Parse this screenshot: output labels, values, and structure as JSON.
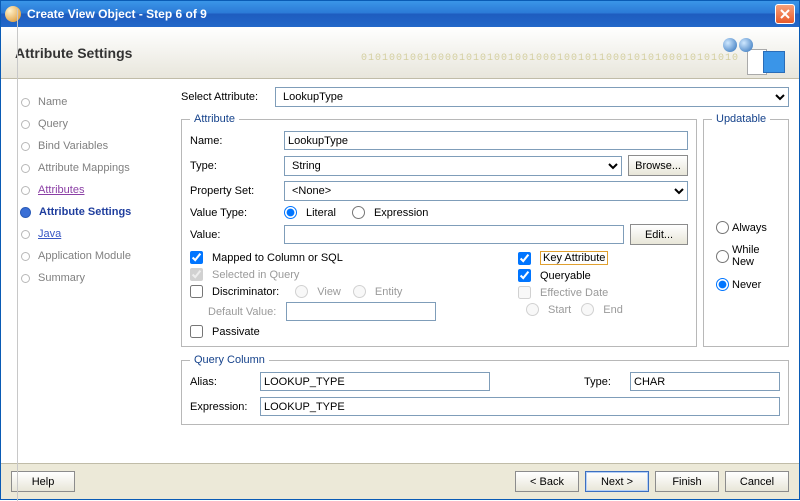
{
  "window": {
    "title": "Create View Object - Step 6 of 9"
  },
  "header": {
    "title": "Attribute Settings",
    "binary": "010100100100001010100100100010010110001010100010101010"
  },
  "nav": {
    "items": [
      {
        "label": "Name"
      },
      {
        "label": "Query"
      },
      {
        "label": "Bind Variables"
      },
      {
        "label": "Attribute Mappings"
      },
      {
        "label": "Attributes"
      },
      {
        "label": "Attribute Settings"
      },
      {
        "label": "Java"
      },
      {
        "label": "Application Module"
      },
      {
        "label": "Summary"
      }
    ]
  },
  "select_attr": {
    "label": "Select Attribute:",
    "value": "LookupType"
  },
  "attribute": {
    "legend": "Attribute",
    "name_label": "Name:",
    "name_value": "LookupType",
    "type_label": "Type:",
    "type_value": "String",
    "browse_btn": "Browse...",
    "propset_label": "Property Set:",
    "propset_value": "<None>",
    "valuetype_label": "Value Type:",
    "literal": "Literal",
    "expression": "Expression",
    "value_label": "Value:",
    "edit_btn": "Edit...",
    "mapped": "Mapped to Column or SQL",
    "selected": "Selected in Query",
    "discriminator": "Discriminator:",
    "view": "View",
    "entity": "Entity",
    "default_value": "Default Value:",
    "passivate": "Passivate",
    "key_attr": "Key Attribute",
    "queryable": "Queryable",
    "effective_date": "Effective Date",
    "start": "Start",
    "end": "End"
  },
  "updatable": {
    "legend": "Updatable",
    "always": "Always",
    "while_new": "While New",
    "never": "Never"
  },
  "query_column": {
    "legend": "Query Column",
    "alias_label": "Alias:",
    "alias_value": "LOOKUP_TYPE",
    "type_label": "Type:",
    "type_value": "CHAR",
    "expression_label": "Expression:",
    "expression_value": "LOOKUP_TYPE"
  },
  "footer": {
    "help": "Help",
    "back": "< Back",
    "next": "Next >",
    "finish": "Finish",
    "cancel": "Cancel"
  }
}
